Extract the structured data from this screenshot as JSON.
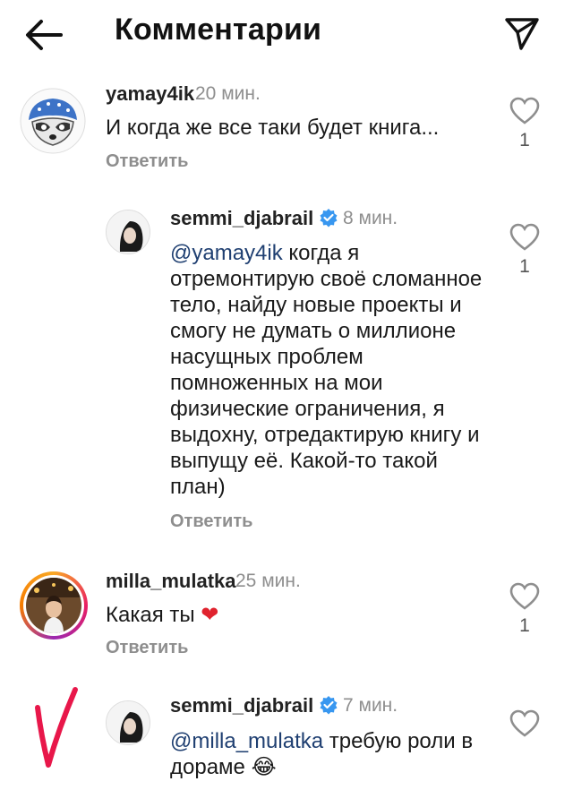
{
  "header": {
    "title": "Комментарии",
    "back_icon": "arrow-left-icon",
    "send_icon": "paper-plane-icon"
  },
  "comments": [
    {
      "username": "yamay4ik",
      "time": "20 мин.",
      "text": "И когда же все таки будет книга...",
      "reply_label": "Ответить",
      "likes": "1"
    },
    {
      "username": "semmi_djabrail",
      "verified": true,
      "time": "8 мин.",
      "mention": "@yamay4ik",
      "text": "когда я отремонтирую своё сломанное тело, найду новые проекты и смогу не думать о миллионе насущных проблем помноженных на мои физические ограничения, я выдохну, отредактирую книгу и выпущу её. Какой-то такой план)",
      "reply_label": "Ответить",
      "likes": "1"
    },
    {
      "username": "milla_mulatka",
      "time": "25 мин.",
      "text": "Какая ты",
      "emoji": "❤",
      "reply_label": "Ответить",
      "likes": "1"
    },
    {
      "username": "semmi_djabrail",
      "verified": true,
      "time": "7 мин.",
      "mention": "@milla_mulatka",
      "text": "требую роли в дораме",
      "emoji": "😂"
    }
  ],
  "colors": {
    "verified": "#3897f0",
    "mention": "#1f3f71",
    "heart": "#e0232e",
    "checkmark": "#e8174a",
    "muted": "#8e8e8e"
  }
}
